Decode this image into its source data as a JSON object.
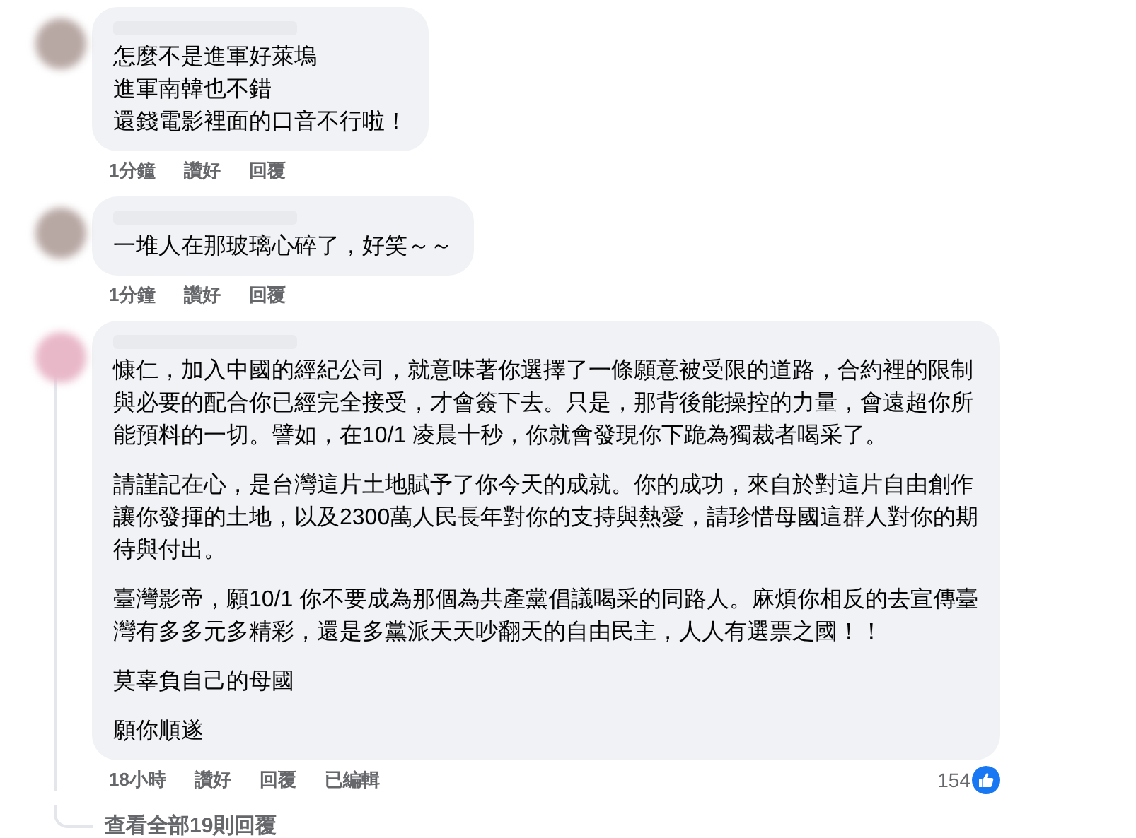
{
  "comments": [
    {
      "lines": [
        "怎麼不是進軍好萊塢",
        "進軍南韓也不錯",
        "還錢電影裡面的口音不行啦！"
      ],
      "actions": [
        "1分鐘",
        "讚好",
        "回覆"
      ]
    },
    {
      "lines": [
        "一堆人在那玻璃心碎了，好笑～～"
      ],
      "actions": [
        "1分鐘",
        "讚好",
        "回覆"
      ]
    },
    {
      "paragraphs": [
        "慷仁，加入中國的經紀公司，就意味著你選擇了一條願意被受限的道路，合約裡的限制與必要的配合你已經完全接受，才會簽下去。只是，那背後能操控的力量，會遠超你所能預料的一切。譬如，在10/1 凌晨十秒，你就會發現你下跪為獨裁者喝采了。",
        "請謹記在心，是台灣這片土地賦予了你今天的成就。你的成功，來自於對這片自由創作讓你發揮的土地，以及2300萬人民長年對你的支持與熱愛，請珍惜母國這群人對你的期待與付出。",
        "臺灣影帝，願10/1 你不要成為那個為共產黨倡議喝采的同路人。麻煩你相反的去宣傳臺灣有多多元多精彩，還是多黨派天天吵翻天的自由民主，人人有選票之國！！",
        "莫辜負自己的母國",
        "願你順遂"
      ],
      "actions": [
        "18小時",
        "讚好",
        "回覆",
        "已編輯"
      ],
      "reaction_count": "154"
    }
  ],
  "view_replies": "查看全部19則回覆"
}
